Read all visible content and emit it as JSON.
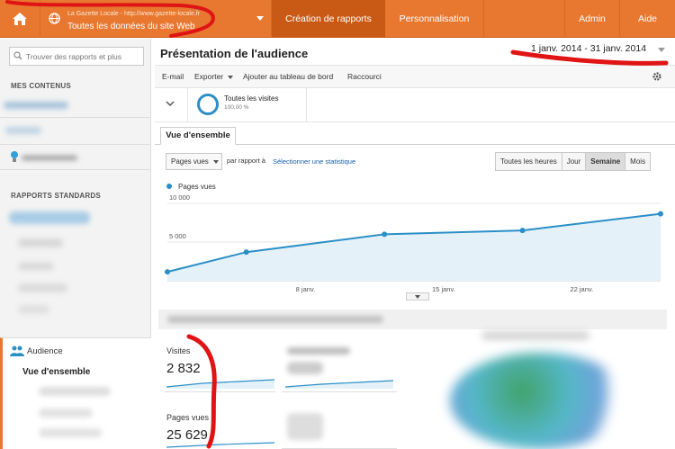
{
  "topbar": {
    "site_url": "La Gazette Locale - http://www.gazette-locale.fr",
    "site_view": "Toutes les données du site Web",
    "nav": [
      {
        "label": "Création de rapports",
        "active": true
      },
      {
        "label": "Personnalisation",
        "active": false
      },
      {
        "label": "Admin",
        "active": false
      },
      {
        "label": "Aide",
        "active": false
      }
    ]
  },
  "sidebar": {
    "search_placeholder": "Trouver des rapports et plus",
    "section_contents": "MES CONTENUS",
    "section_standard": "RAPPORTS STANDARDS",
    "audience": "Audience",
    "overview": "Vue d'ensemble"
  },
  "main": {
    "title": "Présentation de l'audience",
    "date_range": "1 janv. 2014 - 31 janv. 2014",
    "toolbar": {
      "email": "E-mail",
      "export": "Exporter",
      "dashboard": "Ajouter au tableau de bord",
      "shortcut": "Raccourci"
    },
    "segment": {
      "name": "Toutes les visites",
      "percent": "100,00 %"
    },
    "tab": "Vue d'ensemble",
    "metric_select": "Pages vues",
    "compare_label": "par rapport à",
    "select_stat": "Sélectionner une statistique",
    "granularity": [
      {
        "label": "Toutes les heures",
        "active": false
      },
      {
        "label": "Jour",
        "active": false
      },
      {
        "label": "Semaine",
        "active": true
      },
      {
        "label": "Mois",
        "active": false
      }
    ],
    "kpis": [
      {
        "label": "Visites",
        "value": "2 832"
      },
      {
        "label": "Pages vues",
        "value": "25 629"
      }
    ]
  },
  "colors": {
    "accent": "#e8772f",
    "series": "#2b8fc7",
    "area": "#e4f1f8",
    "annotation": "#e01414"
  },
  "chart_data": {
    "type": "area",
    "series": [
      {
        "name": "Pages vues",
        "values": [
          1150,
          3700,
          6000,
          6500,
          8650
        ]
      }
    ],
    "x": [
      "2014-01-01",
      "2014-01-05",
      "2014-01-12",
      "2014-01-19",
      "2014-01-26"
    ],
    "x_tick_labels": [
      "8 janv.",
      "15 janv.",
      "22 janv."
    ],
    "x_ticks": [
      "2014-01-08",
      "2014-01-15",
      "2014-01-22"
    ],
    "xlim": [
      "2014-01-01",
      "2014-01-26"
    ],
    "y_tick_labels": [
      "10 000",
      "5 000"
    ],
    "y_ticks": [
      10000,
      5000
    ],
    "ylim": [
      0,
      10000
    ],
    "legend": "top-left",
    "grid": true
  }
}
